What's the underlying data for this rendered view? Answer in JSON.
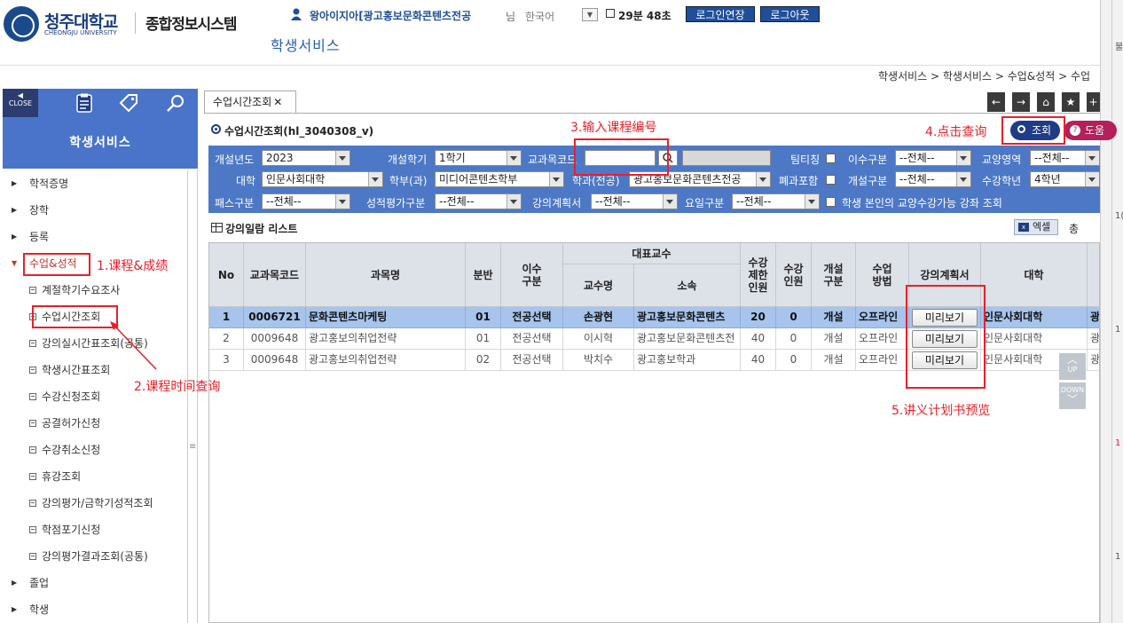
{
  "header": {
    "logo_kr": "청주대학교",
    "logo_en": "CHEONGJU UNIVERSITY",
    "system_title": "종합정보시스템",
    "user_name": "왕아이지아[광고홍보문화콘텐츠전공",
    "user_suffix": "님",
    "language": "한국어",
    "timer": "29분 48초",
    "extend_login": "로그인연장",
    "logout": "로그아웃",
    "section_title": "학생서비스"
  },
  "breadcrumb": "학생서비스 > 학생서비스 > 수업&성적 > 수업",
  "sidebar": {
    "close_label": "CLOSE",
    "title": "학생서비스",
    "items": [
      {
        "label": "학적증명"
      },
      {
        "label": "장학"
      },
      {
        "label": "등록"
      },
      {
        "label": "수업&성적"
      }
    ],
    "sub_items": [
      {
        "label": "계절학기수요조사"
      },
      {
        "label": "수업시간조회"
      },
      {
        "label": "강의실시간표조회(공통)"
      },
      {
        "label": "학생시간표조회"
      },
      {
        "label": "수강신청조회"
      },
      {
        "label": "공결허가신청"
      },
      {
        "label": "수강취소신청"
      },
      {
        "label": "휴강조회"
      },
      {
        "label": "강의평가/금학기성적조회"
      },
      {
        "label": "학점포기신청"
      },
      {
        "label": "강의평가결과조회(공통)"
      }
    ],
    "bottom_items": [
      {
        "label": "졸업"
      },
      {
        "label": "학생"
      }
    ]
  },
  "tab": {
    "label": "수업시간조회"
  },
  "page": {
    "title": "수업시간조회(hl_3040308_v)",
    "search_button": "조회",
    "help_button": "도움"
  },
  "filter": {
    "year_label": "개설년도",
    "year_value": "2023",
    "semester_label": "개설학기",
    "semester_value": "1학기",
    "course_code_label": "교과목코드",
    "team_teaching_label": "팀티칭",
    "completion_type_label": "이수구분",
    "completion_type_value": "--전체--",
    "liberal_area_label": "교양영역",
    "liberal_area_value": "--전체--",
    "college_label": "대학",
    "college_value": "인문사회대학",
    "department_label": "학부(과)",
    "department_value": "미디어콘텐츠학부",
    "major_label": "학과(전공)",
    "major_value": "광고홍보문화콘텐츠전공",
    "closed_label": "폐과포함",
    "open_type_label": "개설구분",
    "open_type_value": "--전체--",
    "grade_label": "수강학년",
    "grade_value": "4학년",
    "pass_type_label": "패스구분",
    "pass_type_value": "--전체--",
    "eval_type_label": "성적평가구분",
    "eval_type_value": "--전체--",
    "plan_label": "강의계획서",
    "plan_value": "--전체--",
    "weekday_label": "요일구분",
    "weekday_value": "--전체--",
    "liberal_only_label": "학생 본인의 교양수강가능 강좌 조회"
  },
  "list": {
    "title": "강의일람 리스트",
    "excel_button": "엑셀",
    "total_label": "총"
  },
  "table": {
    "headers": {
      "no": "No",
      "code": "교과목코드",
      "name": "과목명",
      "section": "분반",
      "completion": "이수\n구분",
      "professor_group": "대표교수",
      "professor": "교수명",
      "affiliation": "소속",
      "limit": "수강\n제한\n인원",
      "enrolled": "수강\n인원",
      "open": "개설\n구분",
      "method": "수업\n방법",
      "plan": "강의계획서",
      "college": "대학"
    },
    "rows": [
      {
        "no": "1",
        "code": "0006721",
        "name": "문화콘텐츠마케팅",
        "section": "01",
        "completion": "전공선택",
        "professor": "손광현",
        "affiliation": "광고홍보문화콘텐츠",
        "limit": "20",
        "enrolled": "0",
        "open": "개설",
        "method": "오프라인",
        "plan": "미리보기",
        "college": "인문사회대학",
        "extra": "광"
      },
      {
        "no": "2",
        "code": "0009648",
        "name": "광고홍보의취업전략",
        "section": "01",
        "completion": "전공선택",
        "professor": "이시혁",
        "affiliation": "광고홍보문화콘텐츠전",
        "limit": "40",
        "enrolled": "0",
        "open": "개설",
        "method": "오프라인",
        "plan": "미리보기",
        "college": "인문사회대학",
        "extra": "광"
      },
      {
        "no": "3",
        "code": "0009648",
        "name": "광고홍보의취업전략",
        "section": "02",
        "completion": "전공선택",
        "professor": "박치수",
        "affiliation": "광고홍보학과",
        "limit": "40",
        "enrolled": "0",
        "open": "개설",
        "method": "오프라인",
        "plan": "미리보기",
        "college": "인문사회대학",
        "extra": "광"
      }
    ]
  },
  "scroll_buttons": {
    "up": "UP",
    "down": "DOWN"
  },
  "annotations": {
    "step1": "1.课程&成绩",
    "step2": "2.课程时间查询",
    "step3": "3.输入课程编号",
    "step4": "4.点击查询",
    "step5": "5.讲义计划书预览"
  },
  "right_strip": [
    "불",
    "1(",
    "1",
    "1",
    "1"
  ],
  "colors": {
    "primary": "#1f4e9a",
    "filter_bg": "#4d78c6",
    "sidebar_bg": "#4a74c9",
    "annotation": "#e8202a",
    "selected_row": "#a6c4ec"
  }
}
